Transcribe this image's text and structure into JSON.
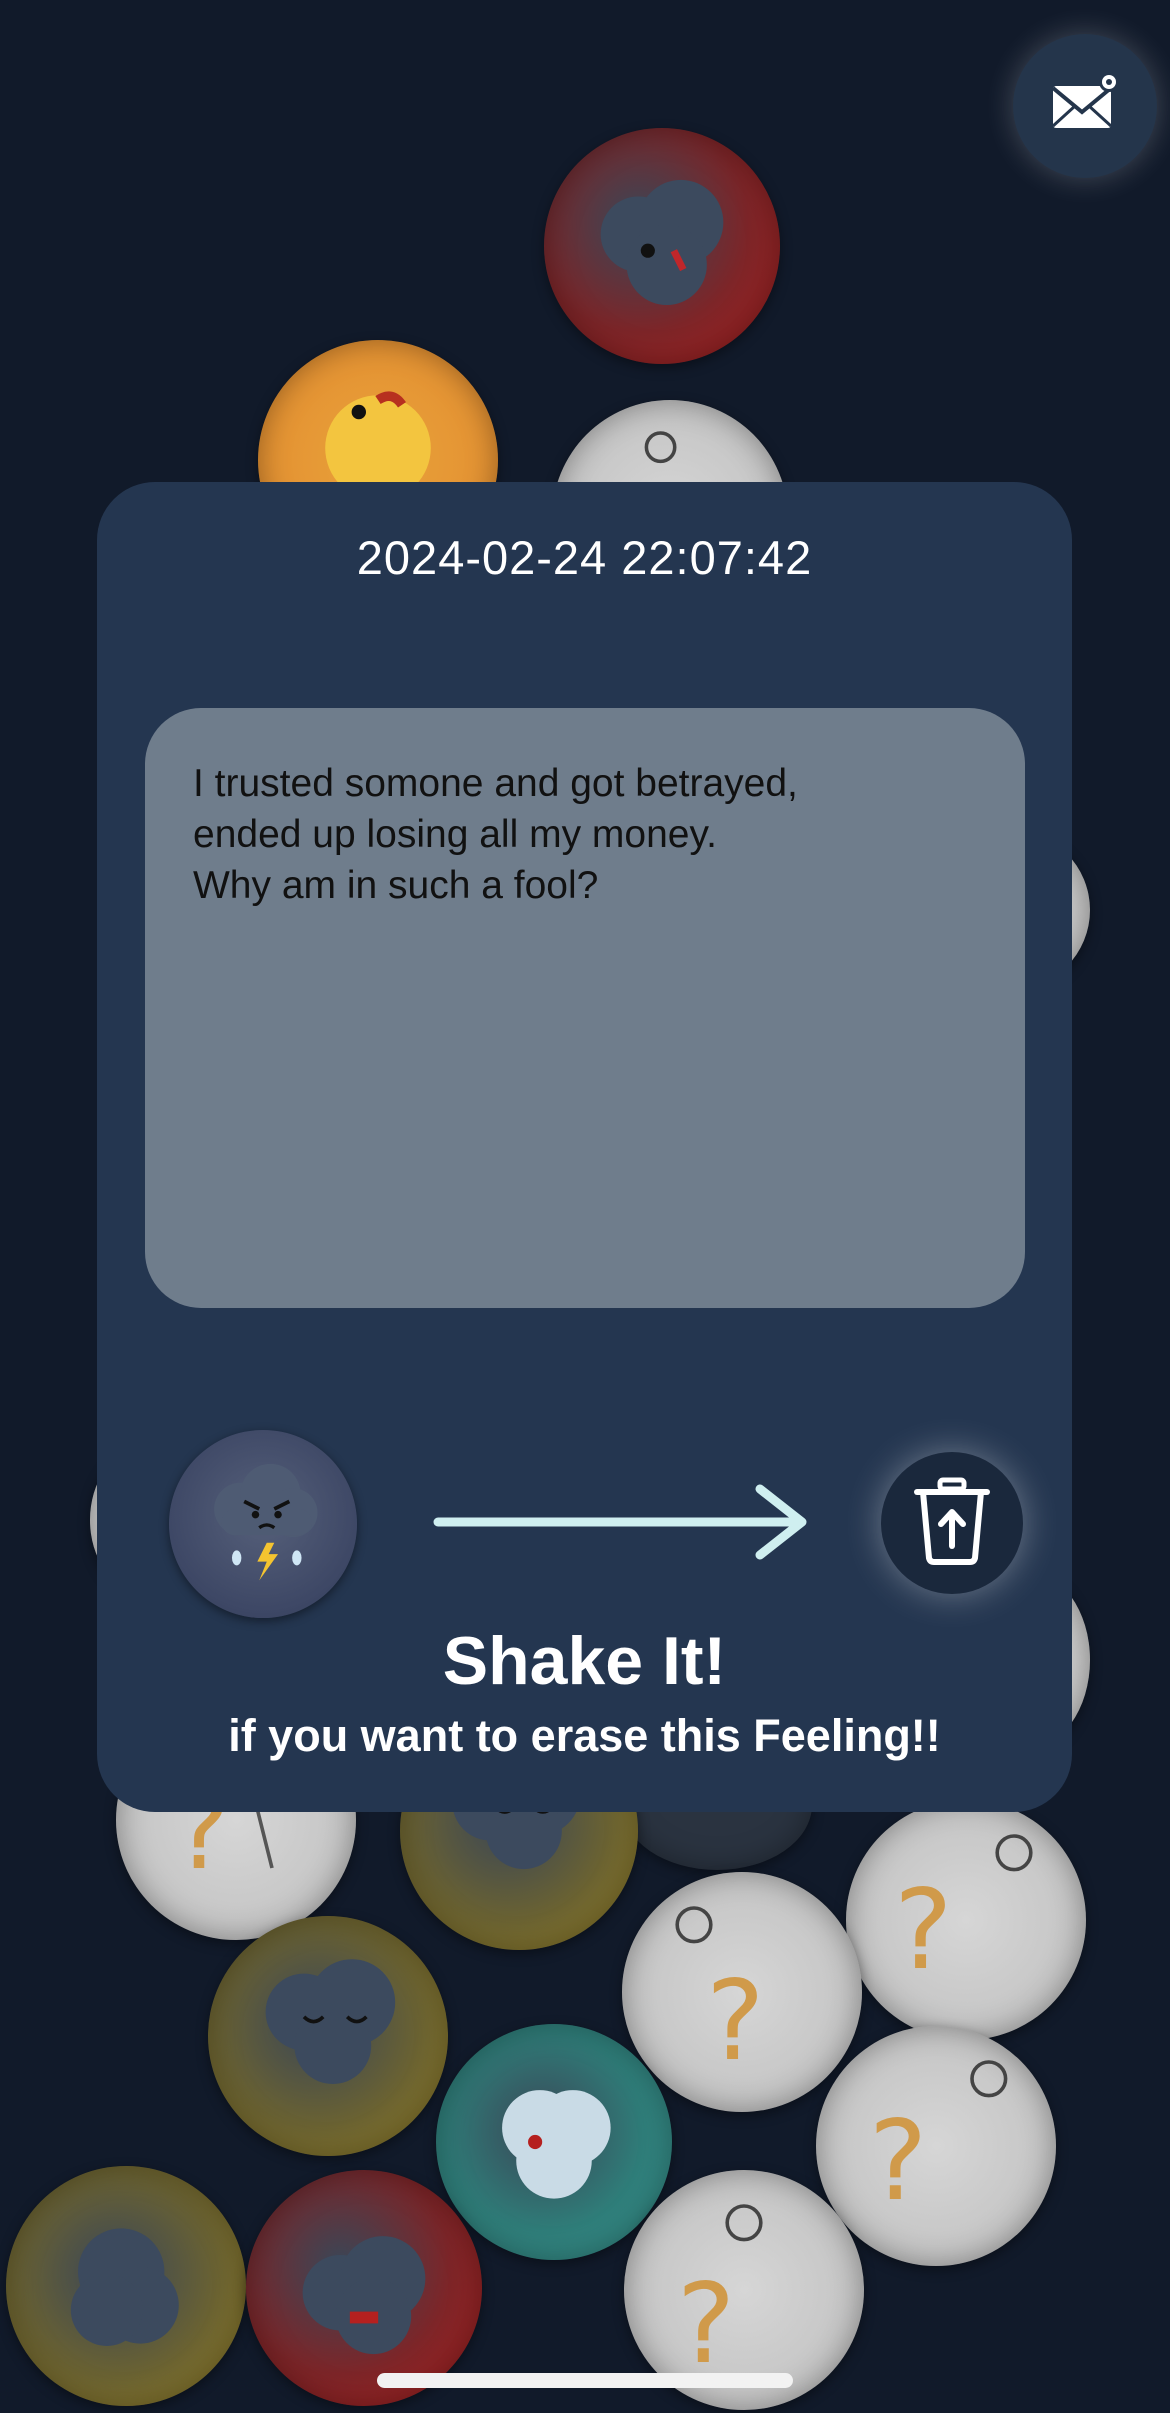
{
  "entry": {
    "timestamp": "2024-02-24 22:07:42",
    "note": "I trusted somone and got betrayed,\nended up losing all my money.\nWhy am in such a fool?"
  },
  "actions": {
    "shake_title": "Shake It!",
    "shake_subtitle": "if you want to erase this Feeling!!"
  },
  "icons": {
    "mail": "mail-pin-icon",
    "trash": "trash-upload-icon",
    "mood": "storm-cloud-icon",
    "arrow": "arrow-right-icon"
  },
  "colors": {
    "background": "#111a2a",
    "card": "#243650",
    "note_box": "#6f7d8c",
    "accent_arrow": "#cfeff0"
  }
}
